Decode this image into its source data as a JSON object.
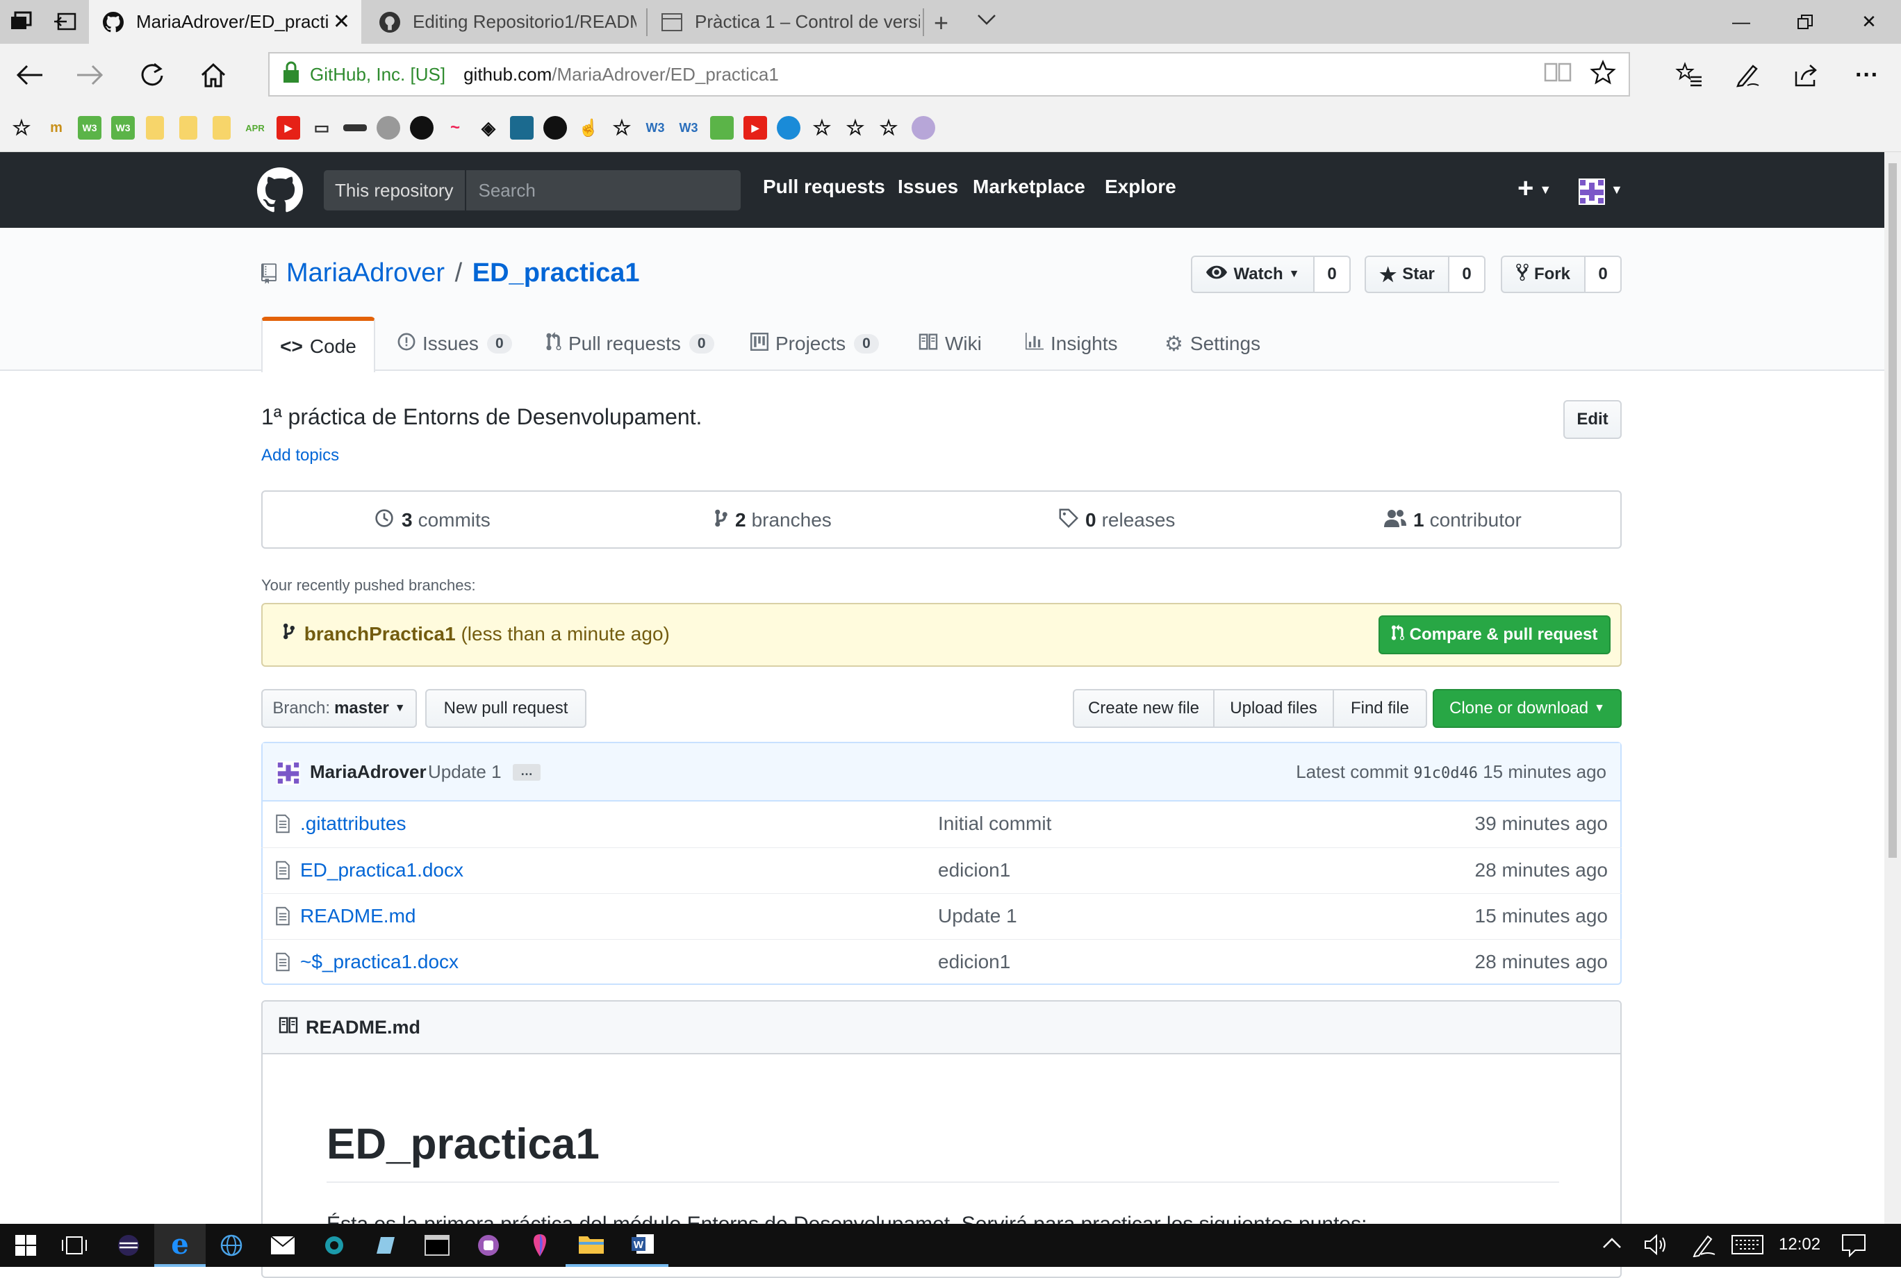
{
  "browser": {
    "tabs": [
      {
        "title": "MariaAdrover/ED_practi",
        "active": true
      },
      {
        "title": "Editing Repositorio1/READM",
        "active": false
      },
      {
        "title": "Pràctica 1 – Control de versi",
        "active": false
      }
    ],
    "cert_label": "GitHub, Inc. [US]",
    "url_host": "github.com",
    "url_path": "/MariaAdrover/ED_practica1",
    "favorites_text": [
      "W3",
      "W3",
      "APR",
      "W3",
      "W3"
    ]
  },
  "github": {
    "scope_label": "This repository",
    "search_placeholder": "Search",
    "nav": [
      "Pull requests",
      "Issues",
      "Marketplace",
      "Explore"
    ],
    "owner": "MariaAdrover",
    "separator": "/",
    "repo": "ED_practica1",
    "watch": {
      "label": "Watch",
      "count": "0"
    },
    "star": {
      "label": "Star",
      "count": "0"
    },
    "fork": {
      "label": "Fork",
      "count": "0"
    },
    "tabs": [
      {
        "label": "Code",
        "count": null
      },
      {
        "label": "Issues",
        "count": "0"
      },
      {
        "label": "Pull requests",
        "count": "0"
      },
      {
        "label": "Projects",
        "count": "0"
      },
      {
        "label": "Wiki",
        "count": null
      },
      {
        "label": "Insights",
        "count": null
      },
      {
        "label": "Settings",
        "count": null
      }
    ],
    "description": "1ª práctica de Entorns de Desenvolupament.",
    "edit_label": "Edit",
    "add_topics": "Add topics",
    "summary": {
      "commits_num": "3",
      "commits_label": "commits",
      "branches_num": "2",
      "branches_label": "branches",
      "releases_num": "0",
      "releases_label": "releases",
      "contributors_num": "1",
      "contributors_label": "contributor"
    },
    "recent_branches_label": "Your recently pushed branches:",
    "recent_branch": {
      "name": "branchPractica1",
      "time": "(less than a minute ago)",
      "button": "Compare & pull request"
    },
    "branch_select": {
      "prefix": "Branch:",
      "value": "master"
    },
    "new_pr": "New pull request",
    "file_actions": [
      "Create new file",
      "Upload files",
      "Find file"
    ],
    "clone": "Clone or download",
    "latest_commit": {
      "author": "MariaAdrover",
      "message": "Update 1",
      "ellipsis": "…",
      "label": "Latest commit",
      "sha": "91c0d46",
      "time": "15 minutes ago"
    },
    "files": [
      {
        "name": ".gitattributes",
        "message": "Initial commit",
        "age": "39 minutes ago"
      },
      {
        "name": "ED_practica1.docx",
        "message": "edicion1",
        "age": "28 minutes ago"
      },
      {
        "name": "README.md",
        "message": "Update 1",
        "age": "15 minutes ago"
      },
      {
        "name": "~$_practica1.docx",
        "message": "edicion1",
        "age": "28 minutes ago"
      }
    ],
    "readme": {
      "header": "README.md",
      "title": "ED_practica1",
      "first_line": "Ésta es la primera práctica del módulo Entorns de Desenvolupamet. Servirá para practicar los siguientes puntos:"
    }
  },
  "taskbar": {
    "clock": "12:02"
  },
  "colors": {
    "accent_green": "#28a745",
    "github_dark": "#24292e",
    "link_blue": "#0366d6",
    "tab_orange": "#e36209",
    "banner_yellow": "#fffbdd"
  }
}
